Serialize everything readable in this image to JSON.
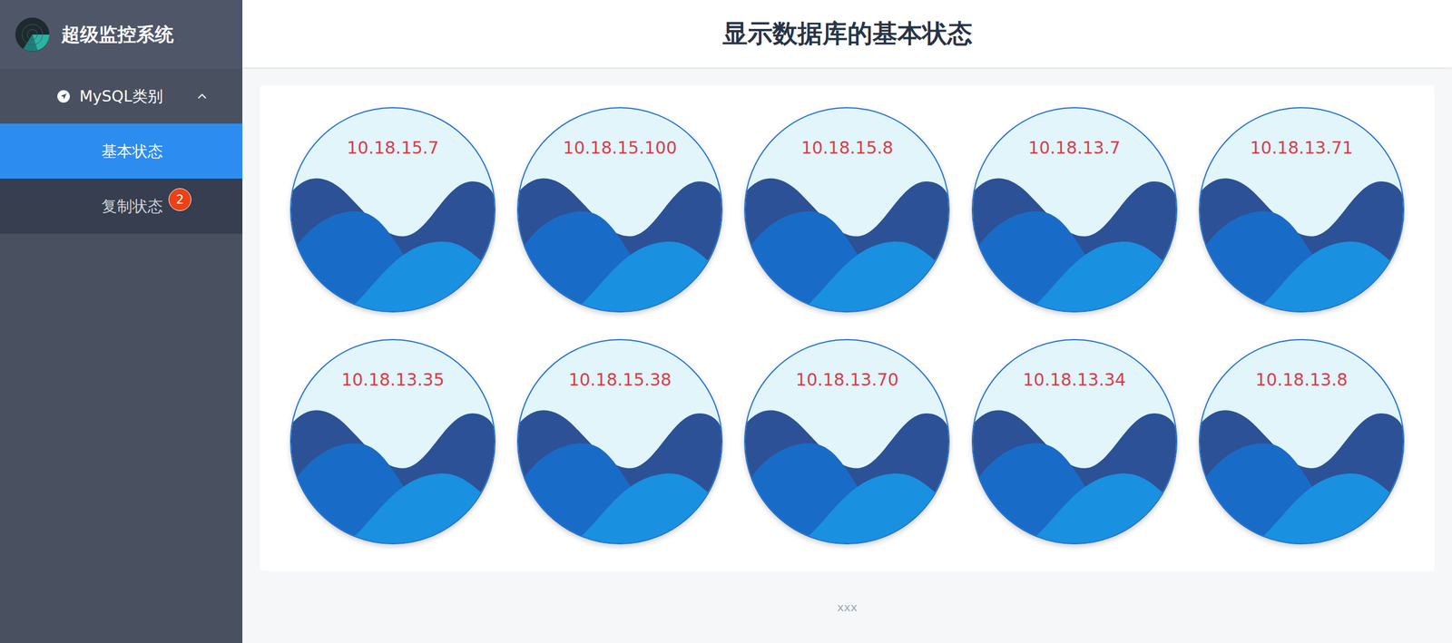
{
  "app": {
    "title": "超级监控系统"
  },
  "header": {
    "title": "显示数据库的基本状态"
  },
  "sidebar": {
    "group": {
      "label": "MySQL类别",
      "expanded": true
    },
    "items": [
      {
        "label": "基本状态",
        "selected": true,
        "badge": ""
      },
      {
        "label": "复制状态",
        "selected": false,
        "badge": "2"
      }
    ]
  },
  "servers": [
    {
      "ip": "10.18.15.7"
    },
    {
      "ip": "10.18.15.100"
    },
    {
      "ip": "10.18.15.8"
    },
    {
      "ip": "10.18.13.7"
    },
    {
      "ip": "10.18.13.71"
    },
    {
      "ip": "10.18.13.35"
    },
    {
      "ip": "10.18.15.38"
    },
    {
      "ip": "10.18.13.70"
    },
    {
      "ip": "10.18.13.34"
    },
    {
      "ip": "10.18.13.8"
    }
  ],
  "footer": "xxx"
}
